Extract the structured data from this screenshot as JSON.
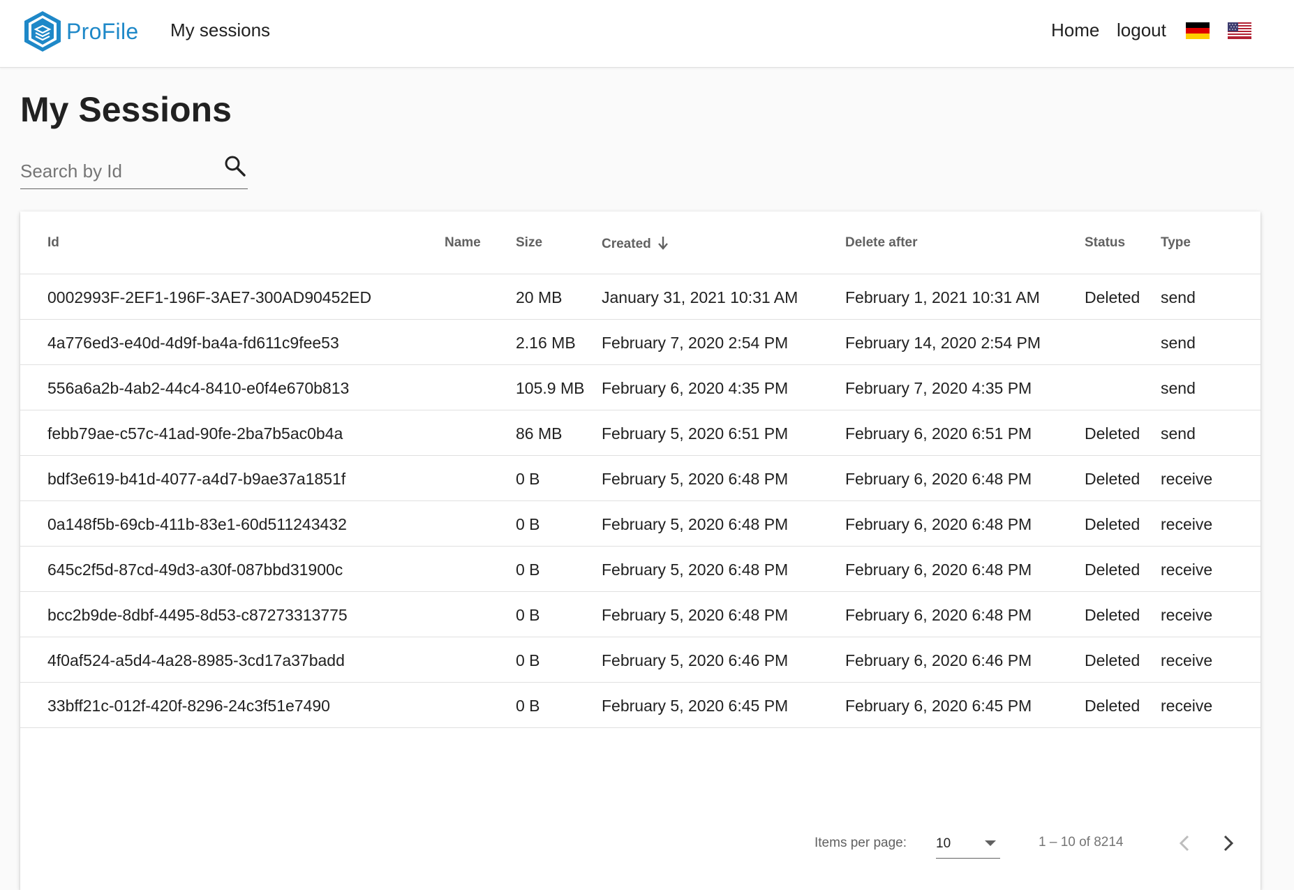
{
  "header": {
    "brand": "ProFile",
    "nav_sessions": "My sessions",
    "nav_home": "Home",
    "nav_logout": "logout",
    "flags": [
      "german-flag",
      "us-flag"
    ]
  },
  "page": {
    "title": "My Sessions"
  },
  "search": {
    "placeholder": "Search by Id"
  },
  "table": {
    "columns": {
      "id": "Id",
      "name": "Name",
      "size": "Size",
      "created": "Created",
      "delete_after": "Delete after",
      "status": "Status",
      "type": "Type"
    },
    "sorted_by": "created",
    "sort_direction": "descending",
    "rows": [
      {
        "id": "0002993F-2EF1-196F-3AE7-300AD90452ED",
        "name": "",
        "size": "20 MB",
        "created": "January 31, 2021 10:31 AM",
        "delete_after": "February 1, 2021 10:31 AM",
        "status": "Deleted",
        "type": "send"
      },
      {
        "id": "4a776ed3-e40d-4d9f-ba4a-fd611c9fee53",
        "name": "",
        "size": "2.16 MB",
        "created": "February 7, 2020 2:54 PM",
        "delete_after": "February 14, 2020 2:54 PM",
        "status": "",
        "type": "send"
      },
      {
        "id": "556a6a2b-4ab2-44c4-8410-e0f4e670b813",
        "name": "",
        "size": "105.9 MB",
        "created": "February 6, 2020 4:35 PM",
        "delete_after": "February 7, 2020 4:35 PM",
        "status": "",
        "type": "send"
      },
      {
        "id": "febb79ae-c57c-41ad-90fe-2ba7b5ac0b4a",
        "name": "",
        "size": "86 MB",
        "created": "February 5, 2020 6:51 PM",
        "delete_after": "February 6, 2020 6:51 PM",
        "status": "Deleted",
        "type": "send"
      },
      {
        "id": "bdf3e619-b41d-4077-a4d7-b9ae37a1851f",
        "name": "",
        "size": "0 B",
        "created": "February 5, 2020 6:48 PM",
        "delete_after": "February 6, 2020 6:48 PM",
        "status": "Deleted",
        "type": "receive"
      },
      {
        "id": "0a148f5b-69cb-411b-83e1-60d511243432",
        "name": "",
        "size": "0 B",
        "created": "February 5, 2020 6:48 PM",
        "delete_after": "February 6, 2020 6:48 PM",
        "status": "Deleted",
        "type": "receive"
      },
      {
        "id": "645c2f5d-87cd-49d3-a30f-087bbd31900c",
        "name": "",
        "size": "0 B",
        "created": "February 5, 2020 6:48 PM",
        "delete_after": "February 6, 2020 6:48 PM",
        "status": "Deleted",
        "type": "receive"
      },
      {
        "id": "bcc2b9de-8dbf-4495-8d53-c87273313775",
        "name": "",
        "size": "0 B",
        "created": "February 5, 2020 6:48 PM",
        "delete_after": "February 6, 2020 6:48 PM",
        "status": "Deleted",
        "type": "receive"
      },
      {
        "id": "4f0af524-a5d4-4a28-8985-3cd17a37badd",
        "name": "",
        "size": "0 B",
        "created": "February 5, 2020 6:46 PM",
        "delete_after": "February 6, 2020 6:46 PM",
        "status": "Deleted",
        "type": "receive"
      },
      {
        "id": "33bff21c-012f-420f-8296-24c3f51e7490",
        "name": "",
        "size": "0 B",
        "created": "February 5, 2020 6:45 PM",
        "delete_after": "February 6, 2020 6:45 PM",
        "status": "Deleted",
        "type": "receive"
      }
    ]
  },
  "paginator": {
    "items_per_page_label": "Items per page:",
    "items_per_page_value": "10",
    "range_label": "1 – 10 of 8214",
    "icons": [
      "chevron-left-icon",
      "chevron-right-icon"
    ]
  },
  "colors": {
    "brand": "#1e88c8",
    "text": "#212121",
    "muted": "#616161",
    "divider": "#e0e0e0"
  }
}
